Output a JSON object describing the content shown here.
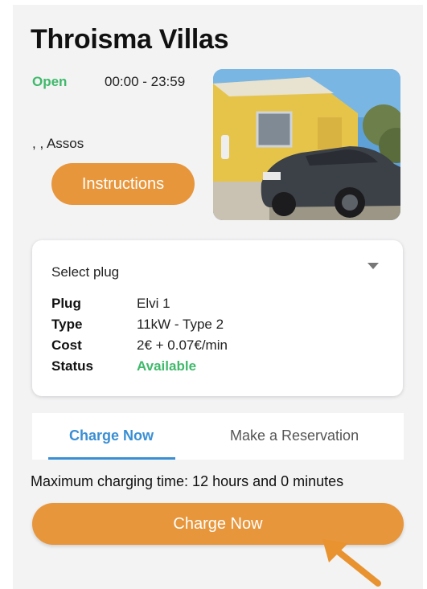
{
  "station": {
    "name": "Throisma Villas",
    "status": "Open",
    "hours": "00:00 - 23:59",
    "address": ", , Assos"
  },
  "buttons": {
    "instructions": "Instructions",
    "charge_now": "Charge Now"
  },
  "plug": {
    "select_label": "Select plug",
    "rows": [
      {
        "key": "Plug",
        "value": "Elvi 1"
      },
      {
        "key": "Type",
        "value": "11kW - Type 2"
      },
      {
        "key": "Cost",
        "value": "2€ + 0.07€/min"
      },
      {
        "key": "Status",
        "value": "Available"
      }
    ]
  },
  "tabs": [
    {
      "label": "Charge Now",
      "active": true
    },
    {
      "label": "Make a Reservation",
      "active": false
    }
  ],
  "max_charging_time": "Maximum charging time: 12 hours and 0 minutes",
  "colors": {
    "accent_orange": "#e8963b",
    "open_green": "#3fb96b",
    "tab_blue": "#3a8fd4"
  },
  "icons": {
    "dropdown": "chevron-down-icon",
    "annotation": "arrow-pointer-icon"
  }
}
